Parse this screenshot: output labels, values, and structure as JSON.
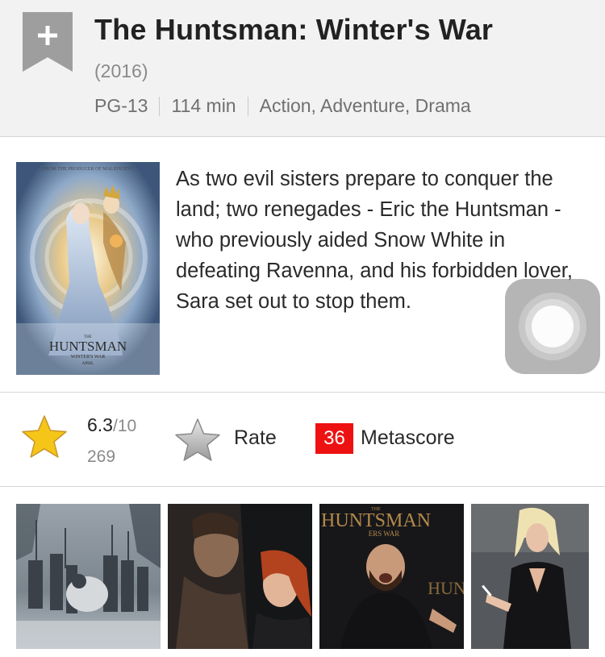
{
  "movie": {
    "title": "The Huntsman: Winter's War",
    "year": "(2016)",
    "rating": "PG-13",
    "runtime": "114 min",
    "genres": "Action, Adventure, Drama",
    "plot": "As two evil sisters prepare to conquer the land; two renegades - Eric the Huntsman - who previously aided Snow White in defeating Ravenna, and his forbidden lover, Sara set out to stop them."
  },
  "poster": {
    "tagline": "FROM THE PRODUCER OF MALEFICENT",
    "logo": "HUNTSMAN",
    "logo_small": "THE",
    "logo_sub": "WINTER'S WAR",
    "date": "APRIL"
  },
  "ratings": {
    "score": "6.3",
    "out_of": "/10",
    "votes": "269",
    "rate_label": "Rate",
    "metascore": "36",
    "metascore_label": "Metascore"
  },
  "gallery": {
    "photo3_logo": "HUNTSMAN",
    "photo3_sub": "ERS WAR",
    "photo3_small": "THE",
    "photo3_side": "HUN"
  },
  "colors": {
    "header_bg": "#f2f2f2",
    "bookmark": "#9e9e9e",
    "star_gold": "#f5c518",
    "metascore_bg": "#ee1111"
  },
  "icons": [
    "bookmark-add-icon",
    "star-filled-icon",
    "star-outline-icon",
    "assistive-touch-icon"
  ]
}
